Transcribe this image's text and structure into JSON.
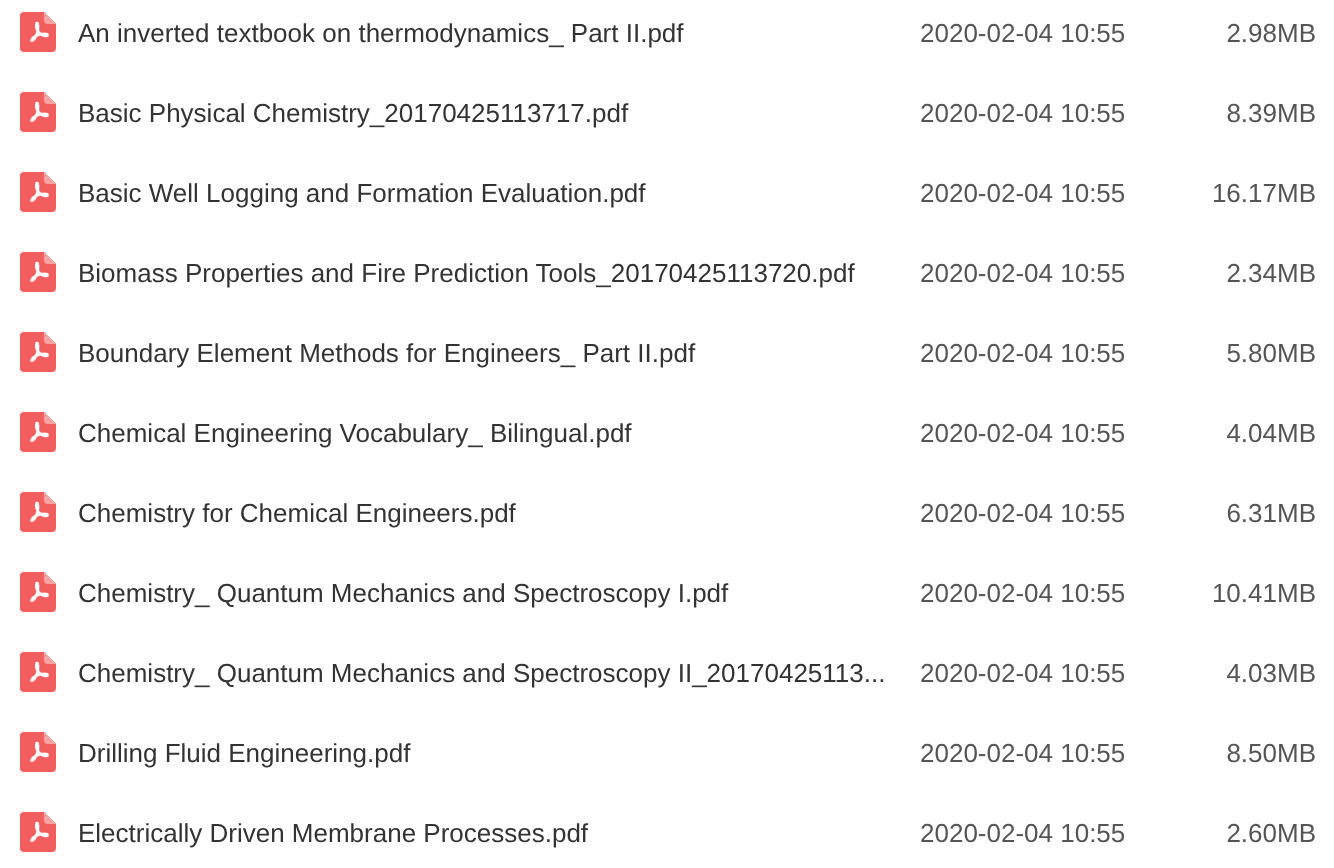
{
  "files": [
    {
      "name": "An inverted textbook on thermodynamics_ Part II.pdf",
      "modified": "2020-02-04 10:55",
      "size": "2.98MB"
    },
    {
      "name": "Basic Physical Chemistry_20170425113717.pdf",
      "modified": "2020-02-04 10:55",
      "size": "8.39MB"
    },
    {
      "name": "Basic Well Logging and Formation Evaluation.pdf",
      "modified": "2020-02-04 10:55",
      "size": "16.17MB"
    },
    {
      "name": "Biomass Properties and Fire Prediction Tools_20170425113720.pdf",
      "modified": "2020-02-04 10:55",
      "size": "2.34MB"
    },
    {
      "name": "Boundary Element Methods for Engineers_ Part II.pdf",
      "modified": "2020-02-04 10:55",
      "size": "5.80MB"
    },
    {
      "name": "Chemical Engineering Vocabulary_ Bilingual.pdf",
      "modified": "2020-02-04 10:55",
      "size": "4.04MB"
    },
    {
      "name": "Chemistry for Chemical Engineers.pdf",
      "modified": "2020-02-04 10:55",
      "size": "6.31MB"
    },
    {
      "name": "Chemistry_ Quantum Mechanics and Spectroscopy I.pdf",
      "modified": "2020-02-04 10:55",
      "size": "10.41MB"
    },
    {
      "name": "Chemistry_ Quantum Mechanics and Spectroscopy II_20170425113...",
      "modified": "2020-02-04 10:55",
      "size": "4.03MB"
    },
    {
      "name": "Drilling Fluid Engineering.pdf",
      "modified": "2020-02-04 10:55",
      "size": "8.50MB"
    },
    {
      "name": "Electrically Driven Membrane Processes.pdf",
      "modified": "2020-02-04 10:55",
      "size": "2.60MB"
    }
  ]
}
